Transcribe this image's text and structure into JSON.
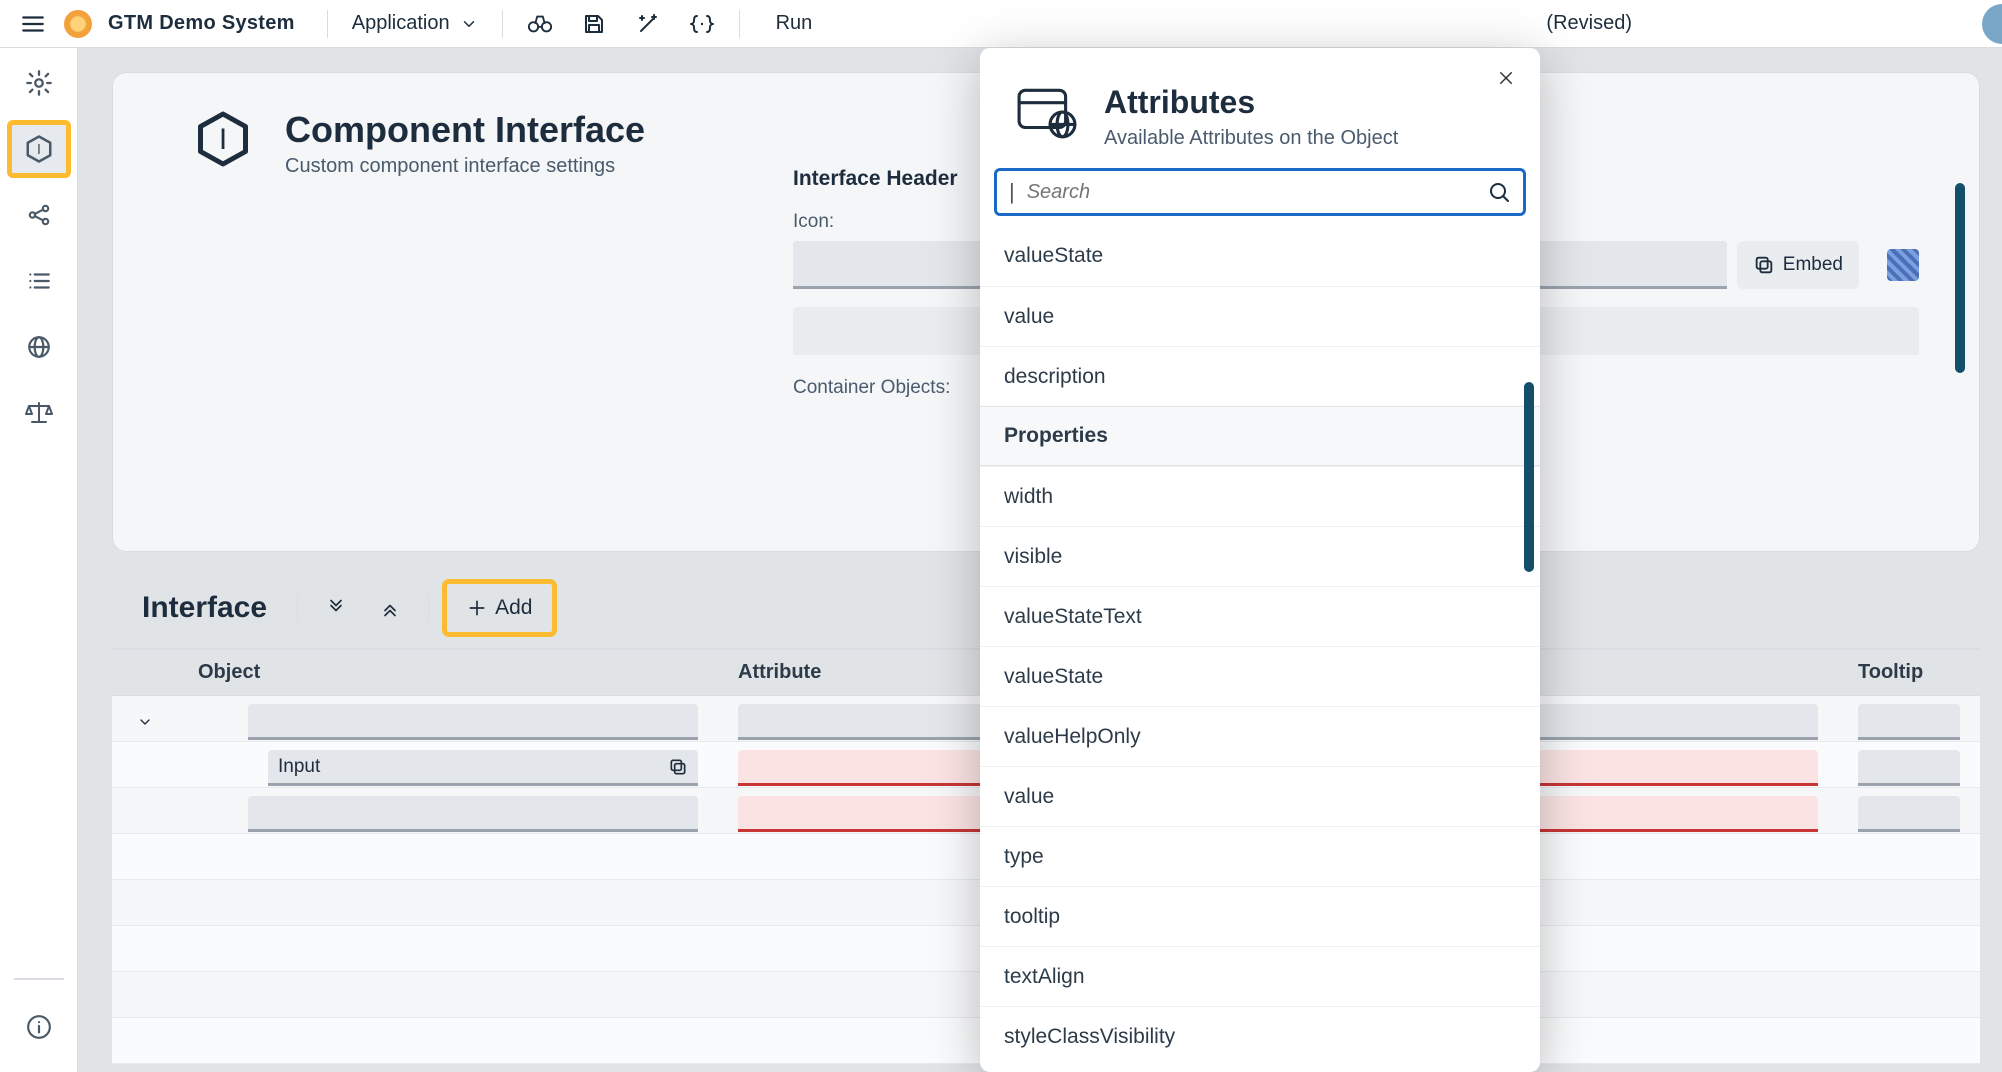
{
  "topbar": {
    "brand": "GTM Demo System",
    "menu": "Application",
    "run": "Run",
    "revised": "(Revised)"
  },
  "page": {
    "title": "Component Interface",
    "subtitle": "Custom component interface settings"
  },
  "form": {
    "header_label": "Interface Header",
    "icon_label": "Icon:",
    "embed_label": "Embed",
    "container_label": "Container Objects:"
  },
  "interface": {
    "title": "Interface",
    "add": "Add",
    "col_object": "Object",
    "col_attribute": "Attribute",
    "col_tooltip": "Tooltip",
    "row2_object": "Input"
  },
  "modal": {
    "title": "Attributes",
    "subtitle": "Available Attributes on the Object",
    "search_placeholder": "Search",
    "section_header": "Properties",
    "items_before": [
      "valueState",
      "value",
      "description"
    ],
    "items_after": [
      "width",
      "visible",
      "valueStateText",
      "valueState",
      "valueHelpOnly",
      "value",
      "type",
      "tooltip",
      "textAlign",
      "styleClassVisibility"
    ]
  }
}
